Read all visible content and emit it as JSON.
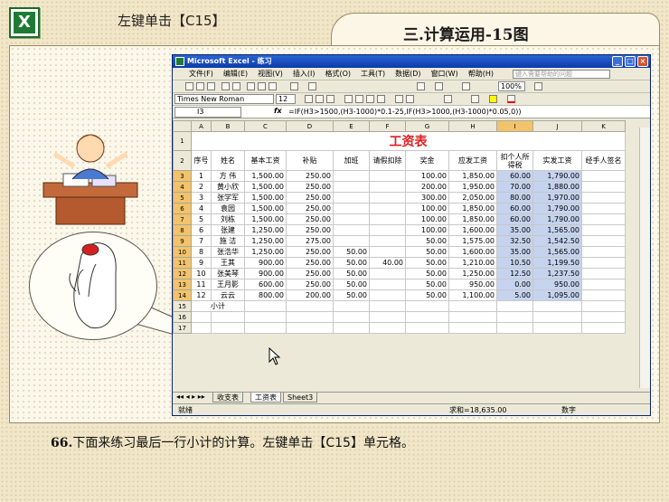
{
  "top_instruction": "左键单击【C15】",
  "page_title": "三.计算运用-15图",
  "bottom_instruction": {
    "num": "66.",
    "text": "下面来练习最后一行小计的计算。左键单击【C15】单元格。"
  },
  "excel": {
    "title": "Microsoft Excel - 练习",
    "menu": [
      "文件(F)",
      "编辑(E)",
      "视图(V)",
      "插入(I)",
      "格式(O)",
      "工具(T)",
      "数据(D)",
      "窗口(W)",
      "帮助(H)"
    ],
    "help_placeholder": "键入需要帮助的问题",
    "font": "Times New Roman",
    "font_size": "12",
    "zoom": "100%",
    "name_box": "I3",
    "fx": "fx",
    "formula": "=IF(H3>1500,(H3-1000)*0.1-25,IF(H3>1000,(H3-1000)*0.05,0))",
    "columns": [
      "A",
      "B",
      "C",
      "D",
      "E",
      "F",
      "G",
      "H",
      "I",
      "J",
      "K"
    ],
    "sheet_title": "工资表",
    "headers": [
      "序号",
      "姓名",
      "基本工资",
      "补贴",
      "加班",
      "请假扣除",
      "奖金",
      "应发工资",
      "扣个人所得税",
      "实发工资",
      "经手人签名"
    ],
    "rows": [
      [
        "1",
        "方 伟",
        "1,500.00",
        "250.00",
        "",
        "",
        "100.00",
        "1,850.00",
        "60.00",
        "1,790.00",
        ""
      ],
      [
        "2",
        "黄小欣",
        "1,500.00",
        "250.00",
        "",
        "",
        "200.00",
        "1,950.00",
        "70.00",
        "1,880.00",
        ""
      ],
      [
        "3",
        "张学军",
        "1,500.00",
        "250.00",
        "",
        "",
        "300.00",
        "2,050.00",
        "80.00",
        "1,970.00",
        ""
      ],
      [
        "4",
        "袁园",
        "1,500.00",
        "250.00",
        "",
        "",
        "100.00",
        "1,850.00",
        "60.00",
        "1,790.00",
        ""
      ],
      [
        "5",
        "刘栋",
        "1,500.00",
        "250.00",
        "",
        "",
        "100.00",
        "1,850.00",
        "60.00",
        "1,790.00",
        ""
      ],
      [
        "6",
        "张建",
        "1,250.00",
        "250.00",
        "",
        "",
        "100.00",
        "1,600.00",
        "35.00",
        "1,565.00",
        ""
      ],
      [
        "7",
        "施 洁",
        "1,250.00",
        "275.00",
        "",
        "",
        "50.00",
        "1,575.00",
        "32.50",
        "1,542.50",
        ""
      ],
      [
        "8",
        "张浩华",
        "1,250.00",
        "250.00",
        "50.00",
        "",
        "50.00",
        "1,600.00",
        "35.00",
        "1,565.00",
        ""
      ],
      [
        "9",
        "王其",
        "900.00",
        "250.00",
        "50.00",
        "40.00",
        "50.00",
        "1,210.00",
        "10.50",
        "1,199.50",
        ""
      ],
      [
        "10",
        "张美琴",
        "900.00",
        "250.00",
        "50.00",
        "",
        "50.00",
        "1,250.00",
        "12.50",
        "1,237.50",
        ""
      ],
      [
        "11",
        "王月影",
        "600.00",
        "250.00",
        "50.00",
        "",
        "50.00",
        "950.00",
        "0.00",
        "950.00",
        ""
      ],
      [
        "12",
        "云云",
        "800.00",
        "200.00",
        "50.00",
        "",
        "50.00",
        "1,100.00",
        "5.00",
        "1,095.00",
        ""
      ]
    ],
    "subtotal_label": "小计",
    "row_numbers": [
      "1",
      "2",
      "3",
      "4",
      "5",
      "6",
      "7",
      "8",
      "9",
      "10",
      "11",
      "12",
      "13",
      "14",
      "15",
      "16",
      "17"
    ],
    "sheet_tabs": [
      "收支表",
      "工资表",
      "Sheet3"
    ],
    "status_left": "就绪",
    "status_sum": "求和=18,635.00",
    "status_right": "数字"
  }
}
